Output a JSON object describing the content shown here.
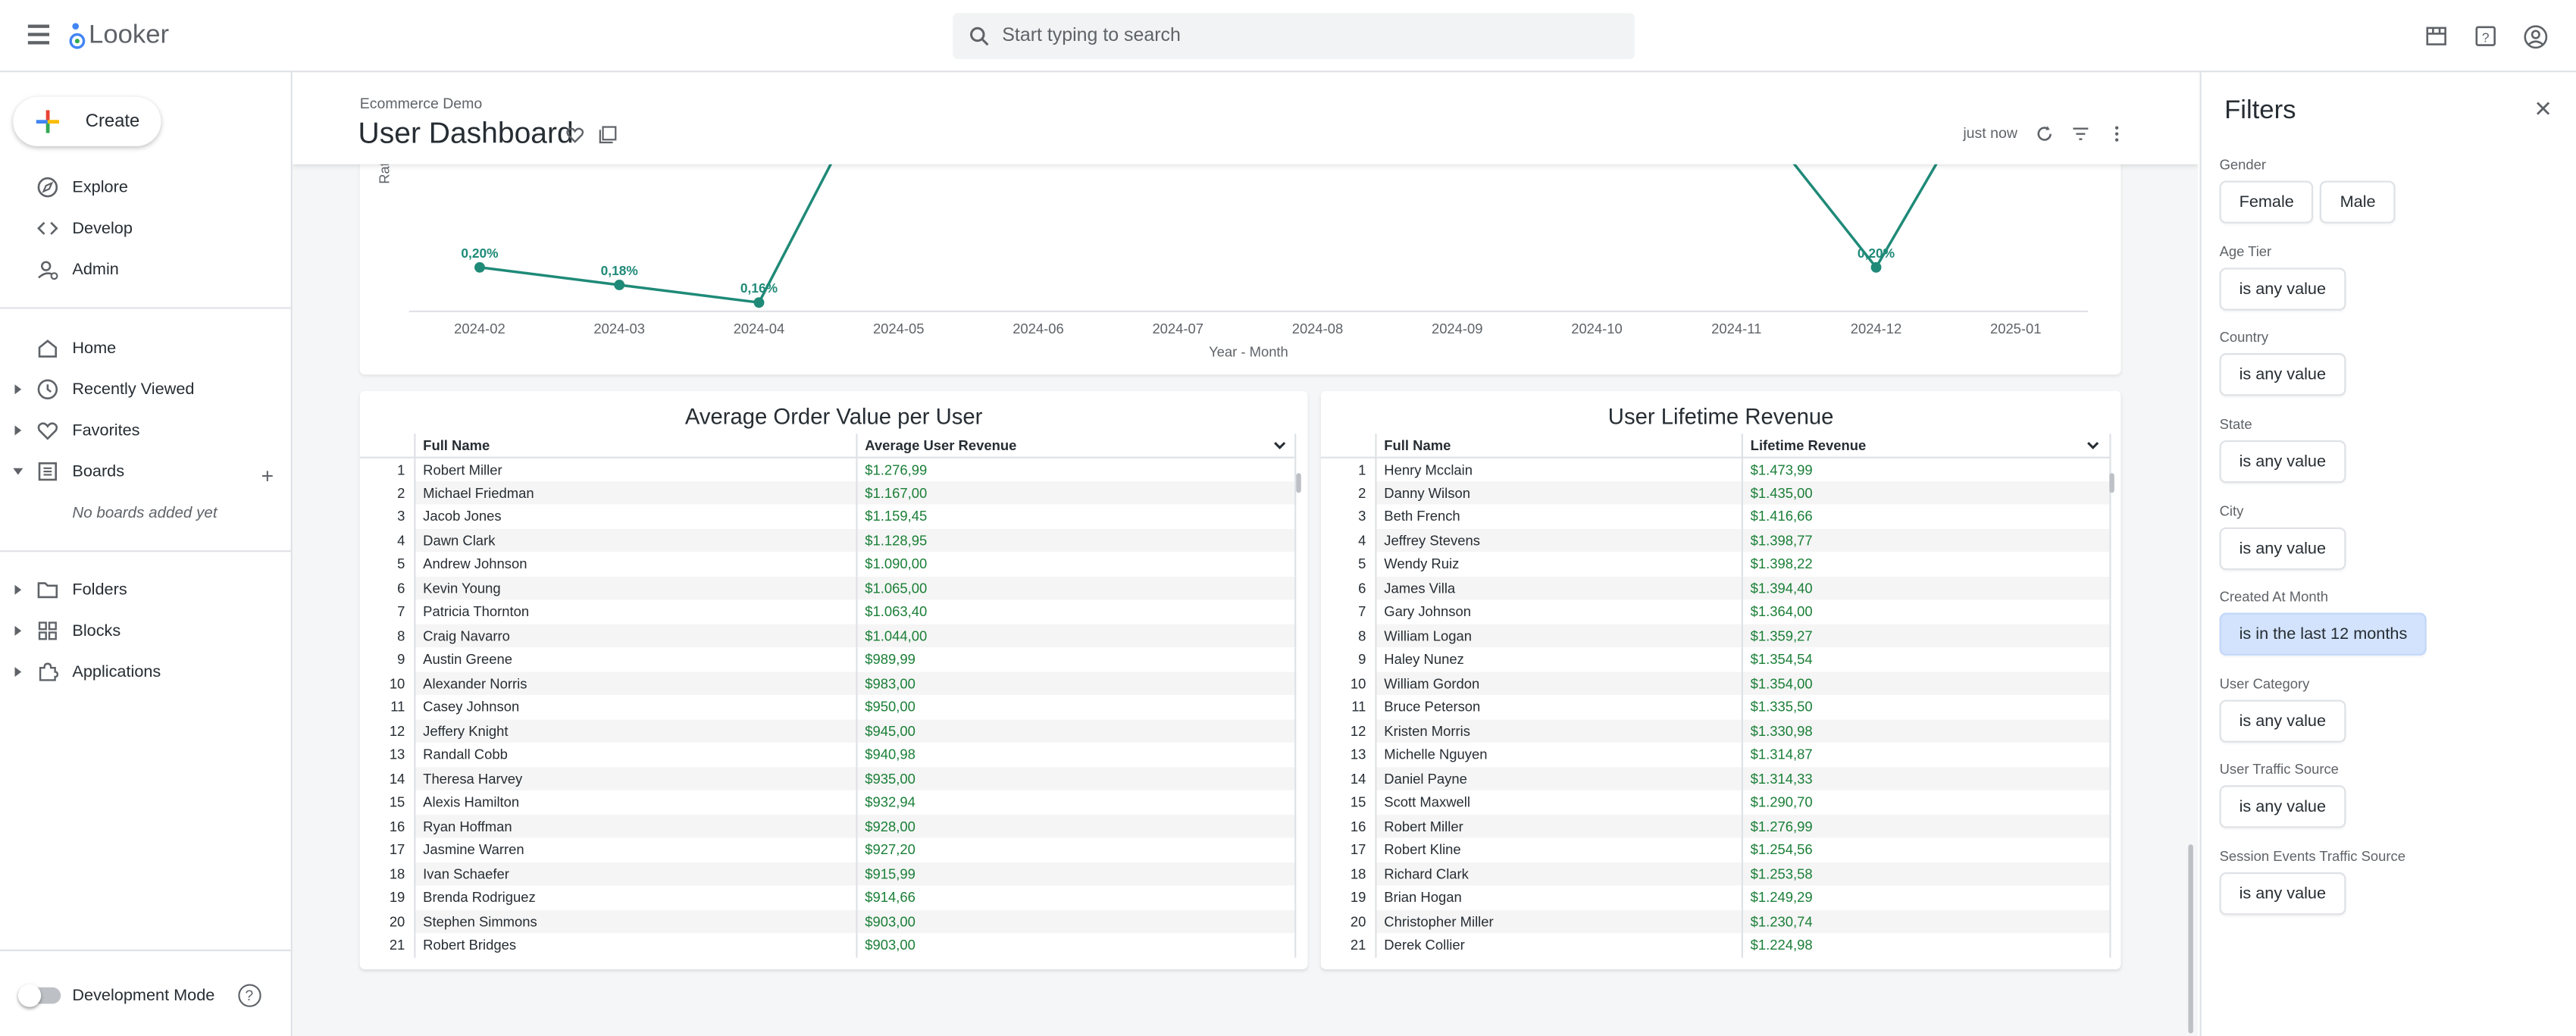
{
  "app": {
    "name": "Looker"
  },
  "search": {
    "placeholder": "Start typing to search"
  },
  "sidebar": {
    "create_label": "Create",
    "items": [
      {
        "label": "Explore"
      },
      {
        "label": "Develop"
      },
      {
        "label": "Admin"
      },
      {
        "label": "Home"
      },
      {
        "label": "Recently Viewed"
      },
      {
        "label": "Favorites"
      },
      {
        "label": "Boards"
      },
      {
        "label": "Folders"
      },
      {
        "label": "Blocks"
      },
      {
        "label": "Applications"
      }
    ],
    "no_boards": "No boards added yet",
    "dev_mode": "Development Mode"
  },
  "dashboard": {
    "breadcrumb": "Ecommerce Demo",
    "title": "User Dashboard",
    "last_run": "just now"
  },
  "chart_data": {
    "type": "line",
    "xlabel": "Year - Month",
    "ylabel": "Rate (%)",
    "categories": [
      "2024-02",
      "2024-03",
      "2024-04",
      "2024-05",
      "2024-06",
      "2024-07",
      "2024-08",
      "2024-09",
      "2024-10",
      "2024-11",
      "2024-12",
      "2025-01"
    ],
    "series": [
      {
        "values": [
          0.2,
          0.18,
          0.16,
          null,
          null,
          null,
          null,
          null,
          null,
          null,
          0.2,
          null
        ]
      }
    ],
    "data_labels": [
      "0,20%",
      "0,18%",
      "0,16%",
      "",
      "",
      "",
      "",
      "",
      "",
      "",
      "0,20%",
      ""
    ],
    "color": "#1f8a78"
  },
  "table_aov": {
    "title": "Average Order Value per User",
    "col_name": "Full Name",
    "col_value": "Average User Revenue",
    "rows": [
      [
        "Robert Miller",
        "$1.276,99"
      ],
      [
        "Michael Friedman",
        "$1.167,00"
      ],
      [
        "Jacob Jones",
        "$1.159,45"
      ],
      [
        "Dawn Clark",
        "$1.128,95"
      ],
      [
        "Andrew Johnson",
        "$1.090,00"
      ],
      [
        "Kevin Young",
        "$1.065,00"
      ],
      [
        "Patricia Thornton",
        "$1.063,40"
      ],
      [
        "Craig Navarro",
        "$1.044,00"
      ],
      [
        "Austin Greene",
        "$989,99"
      ],
      [
        "Alexander Norris",
        "$983,00"
      ],
      [
        "Casey Johnson",
        "$950,00"
      ],
      [
        "Jeffery Knight",
        "$945,00"
      ],
      [
        "Randall Cobb",
        "$940,98"
      ],
      [
        "Theresa Harvey",
        "$935,00"
      ],
      [
        "Alexis Hamilton",
        "$932,94"
      ],
      [
        "Ryan Hoffman",
        "$928,00"
      ],
      [
        "Jasmine Warren",
        "$927,20"
      ],
      [
        "Ivan Schaefer",
        "$915,99"
      ],
      [
        "Brenda Rodriguez",
        "$914,66"
      ],
      [
        "Stephen Simmons",
        "$903,00"
      ],
      [
        "Robert Bridges",
        "$903,00"
      ]
    ]
  },
  "table_ltr": {
    "title": "User Lifetime Revenue",
    "col_name": "Full Name",
    "col_value": "Lifetime Revenue",
    "rows": [
      [
        "Henry Mcclain",
        "$1.473,99"
      ],
      [
        "Danny Wilson",
        "$1.435,00"
      ],
      [
        "Beth French",
        "$1.416,66"
      ],
      [
        "Jeffrey Stevens",
        "$1.398,77"
      ],
      [
        "Wendy Ruiz",
        "$1.398,22"
      ],
      [
        "James Villa",
        "$1.394,40"
      ],
      [
        "Gary Johnson",
        "$1.364,00"
      ],
      [
        "William Logan",
        "$1.359,27"
      ],
      [
        "Haley Nunez",
        "$1.354,54"
      ],
      [
        "William Gordon",
        "$1.354,00"
      ],
      [
        "Bruce Peterson",
        "$1.335,50"
      ],
      [
        "Kristen Morris",
        "$1.330,98"
      ],
      [
        "Michelle Nguyen",
        "$1.314,87"
      ],
      [
        "Daniel Payne",
        "$1.314,33"
      ],
      [
        "Scott Maxwell",
        "$1.290,70"
      ],
      [
        "Robert Miller",
        "$1.276,99"
      ],
      [
        "Robert Kline",
        "$1.254,56"
      ],
      [
        "Richard Clark",
        "$1.253,58"
      ],
      [
        "Brian Hogan",
        "$1.249,29"
      ],
      [
        "Christopher Miller",
        "$1.230,74"
      ],
      [
        "Derek Collier",
        "$1.224,98"
      ]
    ]
  },
  "filters": {
    "title": "Filters",
    "groups": [
      {
        "label": "Gender",
        "values": [
          "Female",
          "Male"
        ]
      },
      {
        "label": "Age Tier",
        "values": [
          "is any value"
        ]
      },
      {
        "label": "Country",
        "values": [
          "is any value"
        ]
      },
      {
        "label": "State",
        "values": [
          "is any value"
        ]
      },
      {
        "label": "City",
        "values": [
          "is any value"
        ]
      },
      {
        "label": "Created At Month",
        "values": [
          "is in the last 12 months"
        ]
      },
      {
        "label": "User Category",
        "values": [
          "is any value"
        ]
      },
      {
        "label": "User Traffic Source",
        "values": [
          "is any value"
        ]
      },
      {
        "label": "Session Events Traffic Source",
        "values": [
          "is any value"
        ]
      }
    ]
  }
}
